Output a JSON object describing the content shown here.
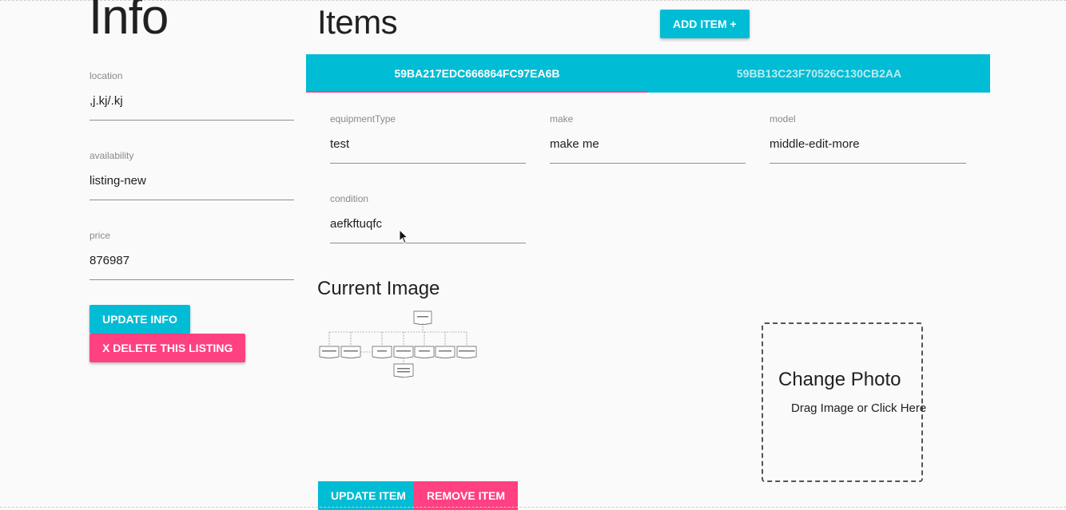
{
  "info": {
    "title": "Info",
    "fields": [
      {
        "label": "location",
        "value": ",j.kj/.kj"
      },
      {
        "label": "availability",
        "value": "listing-new"
      },
      {
        "label": "price",
        "value": "876987"
      }
    ],
    "update_button": "UPDATE INFO",
    "delete_button": "X DELETE THIS LISTING"
  },
  "items": {
    "title": "Items",
    "add_button": "ADD ITEM +",
    "tabs": [
      {
        "label": "59BA217EDC666864FC97EA6B",
        "active": true
      },
      {
        "label": "59BB13C23F70526C130CB2AA",
        "active": false
      }
    ],
    "fields": {
      "equipmentType": {
        "label": "equipmentType",
        "value": "test"
      },
      "make": {
        "label": "make",
        "value": "make me"
      },
      "model": {
        "label": "model",
        "value": "middle-edit-more"
      },
      "condition": {
        "label": "condition",
        "value": "aefkftuqfc"
      }
    },
    "current_image_title": "Current Image",
    "update_button": "UPDATE ITEM",
    "remove_button": "REMOVE ITEM"
  },
  "dropzone": {
    "title": "Change Photo",
    "subtitle": "Drag Image or Click Here"
  },
  "colors": {
    "primary": "#00bcd4",
    "accent": "#ff4081"
  },
  "icons": {
    "cursor": "mouse-pointer-icon"
  }
}
